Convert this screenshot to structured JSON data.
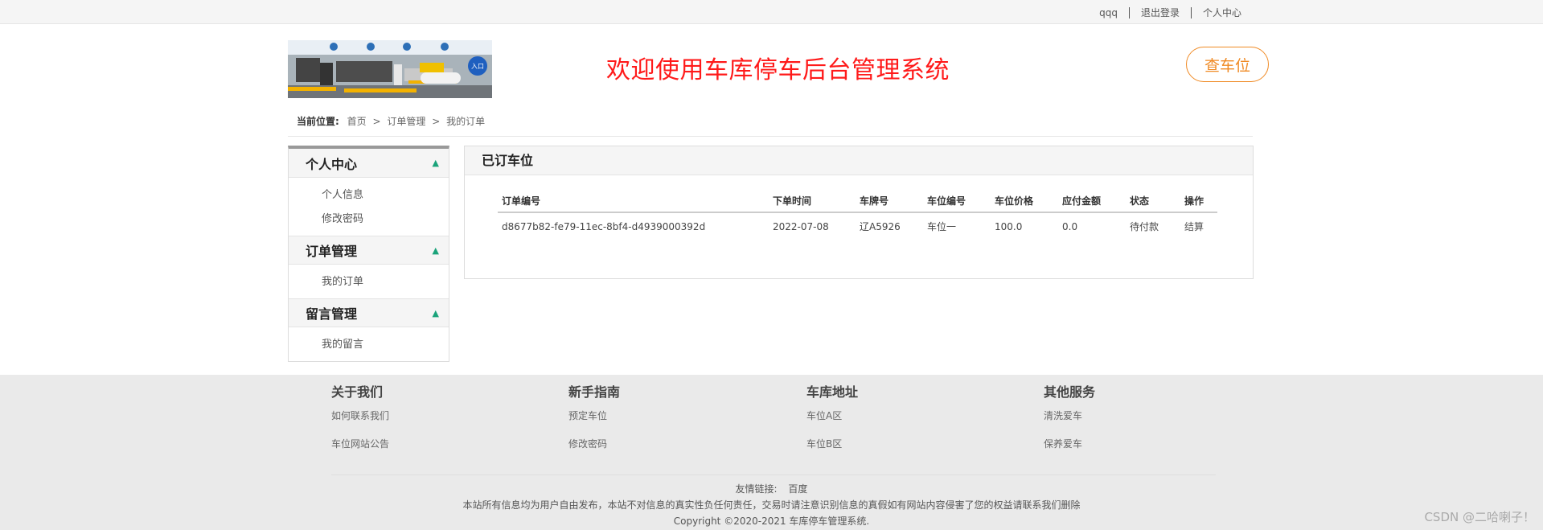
{
  "topbar": {
    "username": "qqq",
    "logout": "退出登录",
    "profile": "个人中心"
  },
  "header": {
    "title": "欢迎使用车库停车后台管理系统",
    "find_button": "查车位",
    "logo_sign": "入口"
  },
  "breadcrumb": {
    "label": "当前位置:",
    "items": [
      "首页",
      "订单管理",
      "我的订单"
    ],
    "separator": ">"
  },
  "sidebar": {
    "groups": [
      {
        "title": "个人中心",
        "items": [
          "个人信息",
          "修改密码"
        ]
      },
      {
        "title": "订单管理",
        "items": [
          "我的订单"
        ]
      },
      {
        "title": "留言管理",
        "items": [
          "我的留言"
        ]
      }
    ]
  },
  "panel": {
    "title": "已订车位",
    "columns": [
      "订单编号",
      "下单时间",
      "车牌号",
      "车位编号",
      "车位价格",
      "应付金额",
      "状态",
      "操作"
    ],
    "rows": [
      [
        "d8677b82-fe79-11ec-8bf4-d4939000392d",
        "2022-07-08",
        "辽A5926",
        "车位一",
        "100.0",
        "0.0",
        "待付款",
        "结算"
      ]
    ],
    "status_color": "#e4393c"
  },
  "footer": {
    "columns": [
      {
        "title": "关于我们",
        "links": [
          "如何联系我们",
          "车位网站公告"
        ]
      },
      {
        "title": "新手指南",
        "links": [
          "预定车位",
          "修改密码"
        ]
      },
      {
        "title": "车库地址",
        "links": [
          "车位A区",
          "车位B区"
        ]
      },
      {
        "title": "其他服务",
        "links": [
          "清洗爱车",
          "保养爱车"
        ]
      }
    ],
    "friend_label": "友情链接:",
    "friend_link": "百度",
    "disclaimer": "本站所有信息均为用户自由发布，本站不对信息的真实性负任何责任，交易时请注意识别信息的真假如有网站内容侵害了您的权益请联系我们删除",
    "copyright": "Copyright ©2020-2021 车库停车管理系统."
  },
  "watermark": "CSDN @二哈喇子！",
  "colors": {
    "accent_orange": "#f08a24",
    "title_red": "#ff1a1a",
    "chevron_green": "#1aa37a"
  }
}
